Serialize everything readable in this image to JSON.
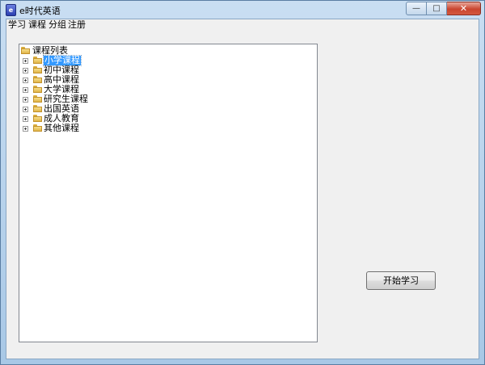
{
  "window": {
    "title": "e时代英语",
    "app_icon_glyph": "e",
    "controls": {
      "minimize": "—",
      "maximize": "□",
      "close": "✕"
    }
  },
  "menubar": {
    "items": [
      "学习",
      "课程",
      "分组",
      "注册"
    ]
  },
  "tree": {
    "root_label": "课程列表",
    "items": [
      {
        "label": "小学课程",
        "selected": true
      },
      {
        "label": "初中课程",
        "selected": false
      },
      {
        "label": "高中课程",
        "selected": false
      },
      {
        "label": "大学课程",
        "selected": false
      },
      {
        "label": "研究生课程",
        "selected": false
      },
      {
        "label": "出国英语",
        "selected": false
      },
      {
        "label": "成人教育",
        "selected": false
      },
      {
        "label": "其他课程",
        "selected": false
      }
    ]
  },
  "actions": {
    "start_label": "开始学习"
  },
  "colors": {
    "selection": "#3399ff",
    "frame": "#a8c8e6",
    "client_bg": "#f0f0f0"
  }
}
